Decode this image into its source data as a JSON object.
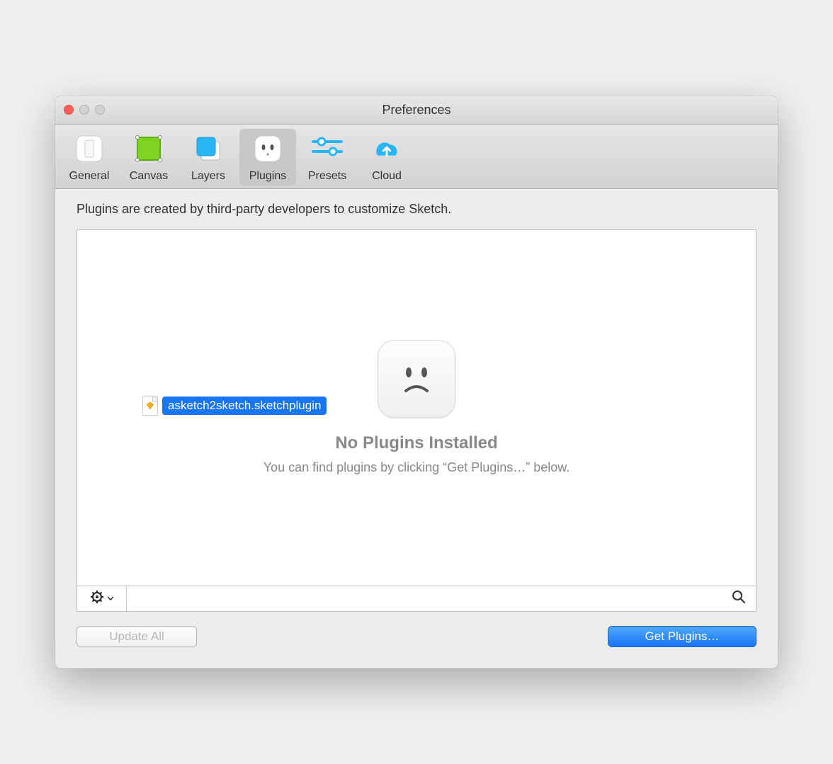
{
  "window": {
    "title": "Preferences"
  },
  "toolbar": {
    "items": [
      {
        "label": "General"
      },
      {
        "label": "Canvas"
      },
      {
        "label": "Layers"
      },
      {
        "label": "Plugins",
        "selected": true
      },
      {
        "label": "Presets"
      },
      {
        "label": "Cloud"
      }
    ]
  },
  "content": {
    "description": "Plugins are created by third-party developers to customize Sketch.",
    "empty_title": "No Plugins Installed",
    "empty_subtitle": "You can find plugins by clicking “Get Plugins…” below.",
    "dragged_file": "asketch2sketch.sketchplugin"
  },
  "footer": {
    "update_all": "Update All",
    "get_plugins": "Get Plugins…"
  }
}
